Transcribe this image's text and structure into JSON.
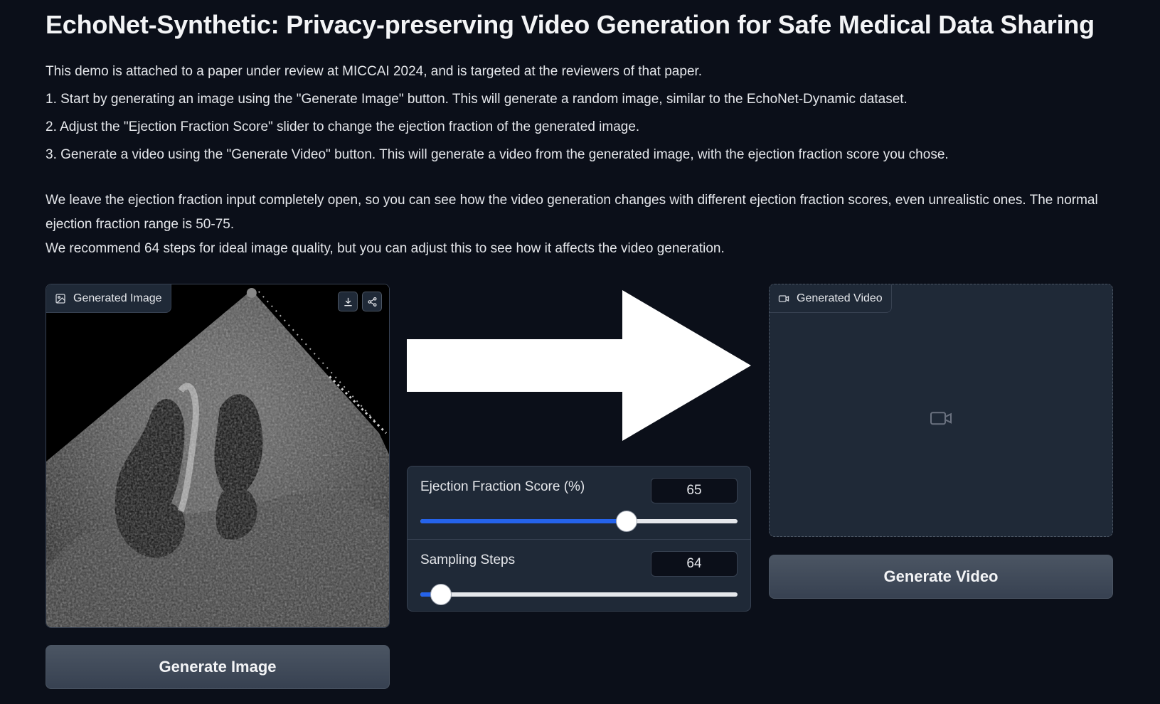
{
  "page": {
    "title": "EchoNet-Synthetic: Privacy-preserving Video Generation for Safe Medical Data Sharing",
    "intro": "This demo is attached to a paper under review at MICCAI 2024, and is targeted at the reviewers of that paper.",
    "steps": [
      "1. Start by generating an image using the \"Generate Image\" button. This will generate a random image, similar to the EchoNet-Dynamic dataset.",
      "2. Adjust the \"Ejection Fraction Score\" slider to change the ejection fraction of the generated image.",
      "3. Generate a video using the \"Generate Video\" button. This will generate a video from the generated image, with the ejection fraction score you chose."
    ],
    "note_ef": "We leave the ejection fraction input completely open, so you can see how the video generation changes with different ejection fraction scores, even unrealistic ones. The normal ejection fraction range is 50-75.",
    "note_steps": "We recommend 64 steps for ideal image quality, but you can adjust this to see how it affects the video generation."
  },
  "image_panel": {
    "label": "Generated Image",
    "icon": "image-icon",
    "download_icon": "download-icon",
    "share_icon": "share-icon"
  },
  "buttons": {
    "generate_image": "Generate Image",
    "generate_video": "Generate Video"
  },
  "controls": {
    "ejection_fraction": {
      "label": "Ejection Fraction Score (%)",
      "value": "65",
      "fraction": 0.65
    },
    "sampling_steps": {
      "label": "Sampling Steps",
      "value": "64",
      "fraction": 0.064
    }
  },
  "video_panel": {
    "label": "Generated Video",
    "icon": "video-icon",
    "placeholder_icon": "video-icon"
  },
  "colors": {
    "background": "#0b0f19",
    "panel": "#1f2937",
    "accent": "#2563eb"
  }
}
